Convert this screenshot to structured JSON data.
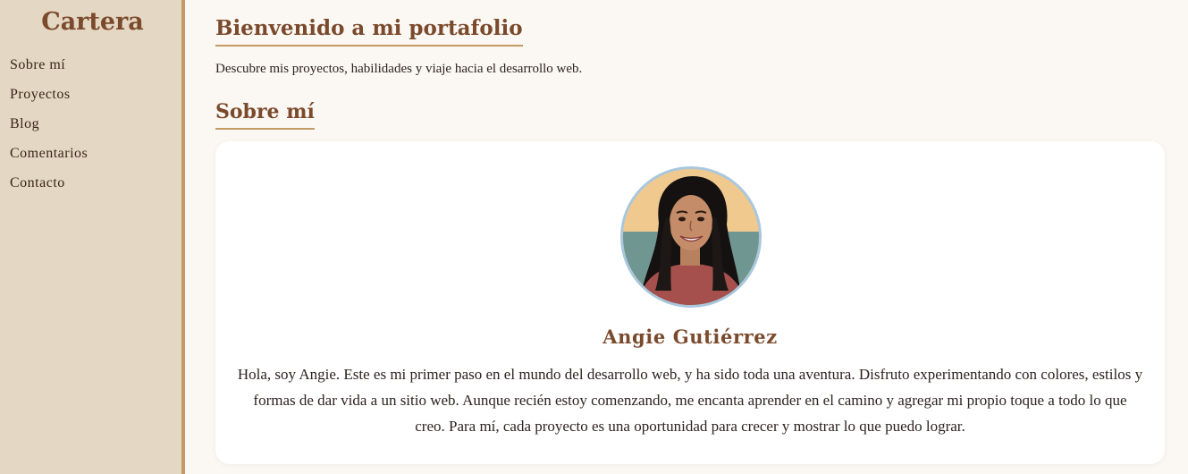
{
  "sidebar": {
    "title": "Cartera",
    "items": [
      {
        "label": "Sobre mí"
      },
      {
        "label": "Proyectos"
      },
      {
        "label": "Blog"
      },
      {
        "label": "Comentarios"
      },
      {
        "label": "Contacto"
      }
    ]
  },
  "main": {
    "heading": "Bienvenido a mi portafolio",
    "tagline": "Descubre mis proyectos, habilidades y viaje hacia el desarrollo web.",
    "section_title": "Sobre mí"
  },
  "profile": {
    "name": "Angie Gutiérrez",
    "bio": "Hola, soy Angie. Este es mi primer paso en el mundo del desarrollo web, y ha sido toda una aventura. Disfruto experimentando con colores, estilos y formas de dar vida a un sitio web. Aunque recién estoy comenzando, me encanta aprender en el camino y agregar mi propio toque a todo lo que creo. Para mí, cada proyecto es una oportunidad para crecer y mostrar lo que puedo lograr."
  },
  "colors": {
    "accent": "#7b4a2c",
    "sidebar_bg": "#e4d8c4",
    "border": "#c49a62",
    "page_bg": "#fbf8f4",
    "avatar_ring": "#a9c7dd"
  }
}
